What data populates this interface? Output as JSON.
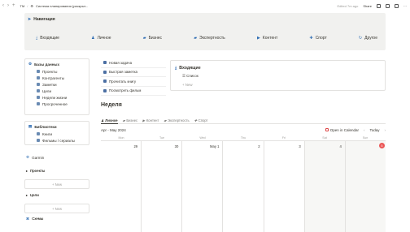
{
  "topbar": {
    "page_title": "Система планирования (раскрыт...",
    "workspace": "TM",
    "edited": "Edited 7m ago",
    "share": "Share"
  },
  "nav": {
    "title": "Навигация",
    "items": [
      {
        "icon": "⤓",
        "label": "Входящие"
      },
      {
        "icon": "♟",
        "label": "Личное"
      },
      {
        "icon": "▰",
        "label": "Бизнес"
      },
      {
        "icon": "▰",
        "label": "Экспертность"
      },
      {
        "icon": "▶",
        "label": "Контент"
      },
      {
        "icon": "✚",
        "label": "Спорт"
      },
      {
        "icon": "↻",
        "label": "Другое"
      }
    ]
  },
  "databases": {
    "title": "Базы данных",
    "items": [
      "Проекты",
      "Контрагенты",
      "Заметки",
      "Цели",
      "Недели жизни",
      "Просроченное"
    ]
  },
  "libraries": {
    "title": "Библиотеки",
    "items": [
      "Книги",
      "Фильмы / сериалы"
    ]
  },
  "sections": {
    "garmin": "Garmin",
    "projects": "Проекты",
    "goals": "Цели",
    "schemes": "Схемы",
    "new": "+ New"
  },
  "quick": [
    "Новая задача",
    "Быстрая заметка",
    "Прочитать книгу",
    "Посмотреть фильм"
  ],
  "inbox": {
    "title": "Входящие",
    "list": "Список",
    "new": "+ New"
  },
  "week": {
    "title": "Неделя",
    "tabs": [
      "Личное",
      "Бизнес",
      "Контент",
      "Экспертность",
      "Спорт"
    ],
    "month": "Apr - May 2024",
    "open_calendar": "Open in Calendar",
    "today": "Today"
  },
  "calendar": {
    "dow": [
      "Mon",
      "Tue",
      "Wed",
      "Thu",
      "Fri",
      "Sat",
      "Sun"
    ],
    "days": [
      "29",
      "30",
      "May 1",
      "2",
      "3",
      "4",
      "5"
    ],
    "today_index": 6
  }
}
